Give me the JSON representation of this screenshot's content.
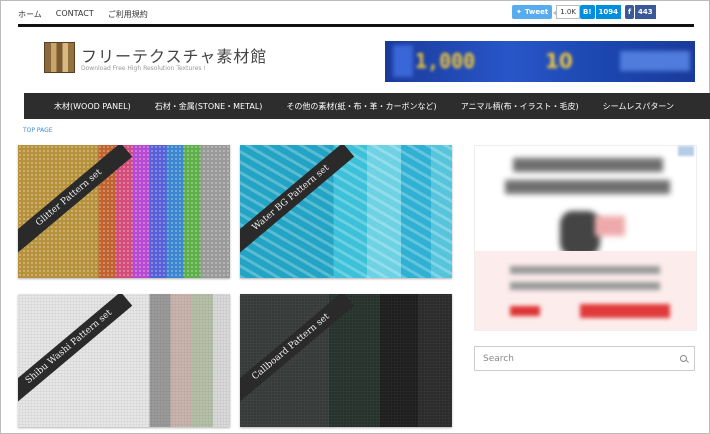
{
  "top_nav": [
    "ホーム",
    "CONTACT",
    "ご利用規約"
  ],
  "share": {
    "tweet_label": "Tweet",
    "tweet_count": "1.0K",
    "hatena_label": "B!",
    "hatena_count": "1094",
    "facebook_label": "f",
    "facebook_count": "443"
  },
  "site": {
    "title": "フリーテクスチャ素材館",
    "subtitle": "Download Free High Resolution Textures !"
  },
  "banner": {
    "text_a": "1,000",
    "text_b": "10"
  },
  "main_nav": [
    "木材(WOOD PANEL)",
    "石材・金属(STONE・METAL)",
    "その他の素材(紙・布・革・カーボンなど)",
    "アニマル柄(布・イラスト・毛皮)",
    "シームレスパターン"
  ],
  "breadcrumb": "TOP PAGE",
  "cards": [
    {
      "title": "Glitter Pattern set"
    },
    {
      "title": "Water BG Pattern set"
    },
    {
      "title": "Shibu Washi Pattern set"
    },
    {
      "title": "Callboard Pattern set"
    }
  ],
  "search": {
    "placeholder": "Search"
  },
  "colors": {
    "nav_bg": "#2d2d2d",
    "link": "#3a8bd4",
    "twitter": "#55acee",
    "hatena": "#008fde",
    "facebook": "#3b5998"
  }
}
